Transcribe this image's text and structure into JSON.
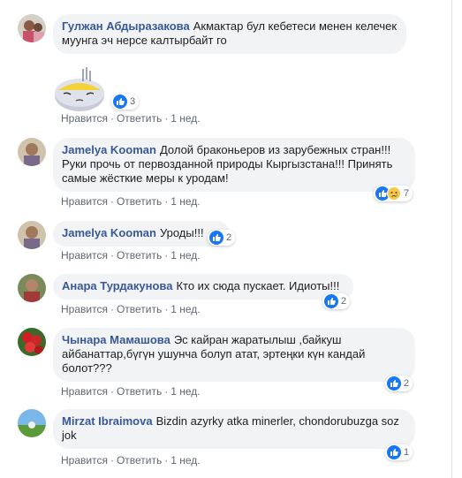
{
  "actions": {
    "like": "Нравится",
    "reply": "Ответить",
    "separator": "·"
  },
  "comments": [
    {
      "author": "Гулжан Абдыразакова",
      "text": "Акмактар бул кебетеси менен келечек муунга эч нерсе калтырбайт го",
      "time": "1 нед.",
      "reaction_count": "3",
      "avatar_color": "#c9516a"
    },
    {
      "author": "Jamelya Kooman",
      "text": "Долой браконьеров из зарубежных стран!!! Руки прочь от первозданной природы Кыргызстана!!! Принять самые жёсткие меры к уродам!",
      "time": "1 нед.",
      "reaction_count": "7",
      "avatar_color": "#a88b6c"
    },
    {
      "author": "Jamelya Kooman",
      "text": "Уроды!!!",
      "time": "1 нед.",
      "reaction_count": "2",
      "avatar_color": "#a88b6c"
    },
    {
      "author": "Анара Турдакунова",
      "text": "Кто их сюда пускает. Идиоты!!!",
      "time": "1 нед.",
      "reaction_count": "2",
      "avatar_color": "#a33a3a"
    },
    {
      "author": "Чынара Мамашова",
      "text": "Эс кайран жаратылыш ,байкуш айбанаттар,бүгүн ушунча болуп атат, эртеңки күн кандай болот???",
      "time": "1 нед.",
      "reaction_count": "2",
      "avatar_color": "#c8282a"
    },
    {
      "author": "Mirzat Ibraimova",
      "text": "Bizdin azyrky atka minerler, chondorubuzga soz jok",
      "time": "1 нед.",
      "reaction_count": "1",
      "avatar_color": "#5aa0d8"
    }
  ],
  "colors": {
    "link": "#385898",
    "meta": "#606770",
    "bubble": "#f2f3f5",
    "like_blue": "#1877f2"
  }
}
